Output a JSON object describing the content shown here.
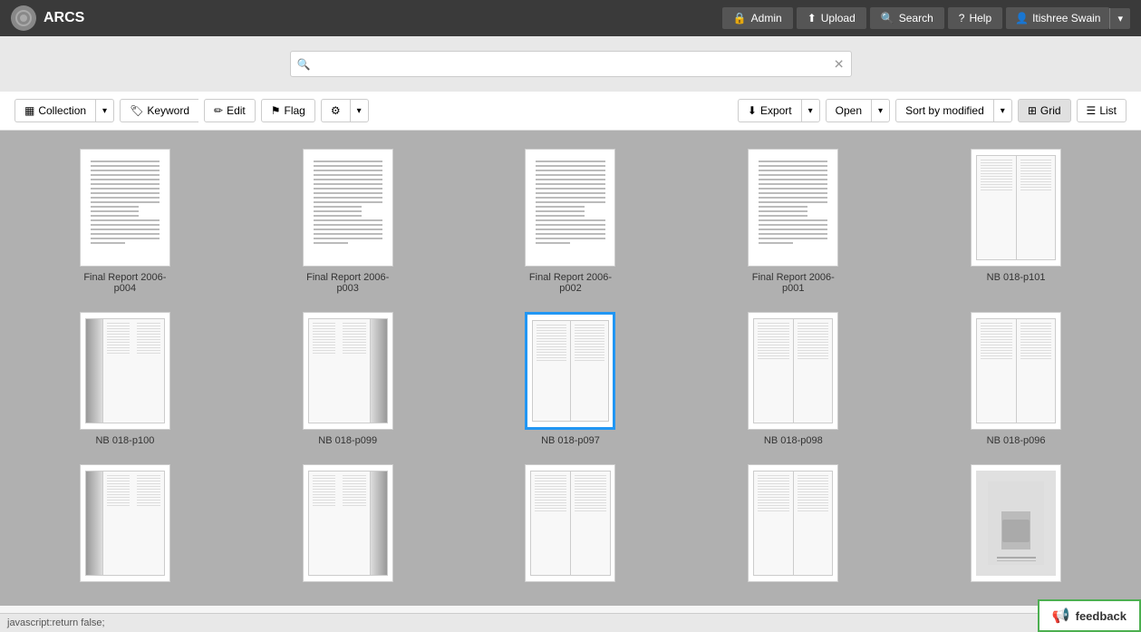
{
  "app": {
    "name": "ARCS",
    "logo_char": "⊙"
  },
  "navbar": {
    "admin_label": "Admin",
    "upload_label": "Upload",
    "search_label": "Search",
    "help_label": "Help",
    "user_label": "Itishree Swain",
    "admin_icon": "🔒",
    "upload_icon": "↑",
    "search_icon": "🔍",
    "help_icon": "?"
  },
  "search": {
    "placeholder": "",
    "clear_icon": "✕"
  },
  "toolbar": {
    "collection_label": "Collection",
    "keyword_label": "Keyword",
    "edit_label": "Edit",
    "flag_label": "Flag",
    "settings_icon": "⚙",
    "export_label": "Export",
    "open_label": "Open",
    "sort_label": "Sort by modified",
    "grid_label": "Grid",
    "list_label": "List"
  },
  "grid": {
    "items": [
      {
        "id": 1,
        "label": "Final Report 2006-p004",
        "type": "document",
        "selected": false
      },
      {
        "id": 2,
        "label": "Final Report 2006-p003",
        "type": "document",
        "selected": false
      },
      {
        "id": 3,
        "label": "Final Report 2006-p002",
        "type": "document",
        "selected": false
      },
      {
        "id": 4,
        "label": "Final Report 2006-p001",
        "type": "document",
        "selected": false
      },
      {
        "id": 5,
        "label": "NB 018-p101",
        "type": "notebook_open",
        "selected": false
      },
      {
        "id": 6,
        "label": "NB 018-p100",
        "type": "notebook_shadow_left",
        "selected": false
      },
      {
        "id": 7,
        "label": "NB 018-p099",
        "type": "notebook_shadow_right",
        "selected": false
      },
      {
        "id": 8,
        "label": "NB 018-p097",
        "type": "notebook_plain",
        "selected": true
      },
      {
        "id": 9,
        "label": "NB 018-p098",
        "type": "notebook_plain",
        "selected": false
      },
      {
        "id": 10,
        "label": "NB 018-p096",
        "type": "notebook_plain",
        "selected": false
      },
      {
        "id": 11,
        "label": "",
        "type": "notebook_shadow_left",
        "selected": false
      },
      {
        "id": 12,
        "label": "",
        "type": "notebook_shadow_right",
        "selected": false
      },
      {
        "id": 13,
        "label": "",
        "type": "notebook_plain",
        "selected": false
      },
      {
        "id": 14,
        "label": "",
        "type": "notebook_plain",
        "selected": false
      },
      {
        "id": 15,
        "label": "",
        "type": "photo",
        "selected": false
      }
    ]
  },
  "bottom": {
    "js_text": "javascript:return false;",
    "feedback_label": "feedback"
  }
}
